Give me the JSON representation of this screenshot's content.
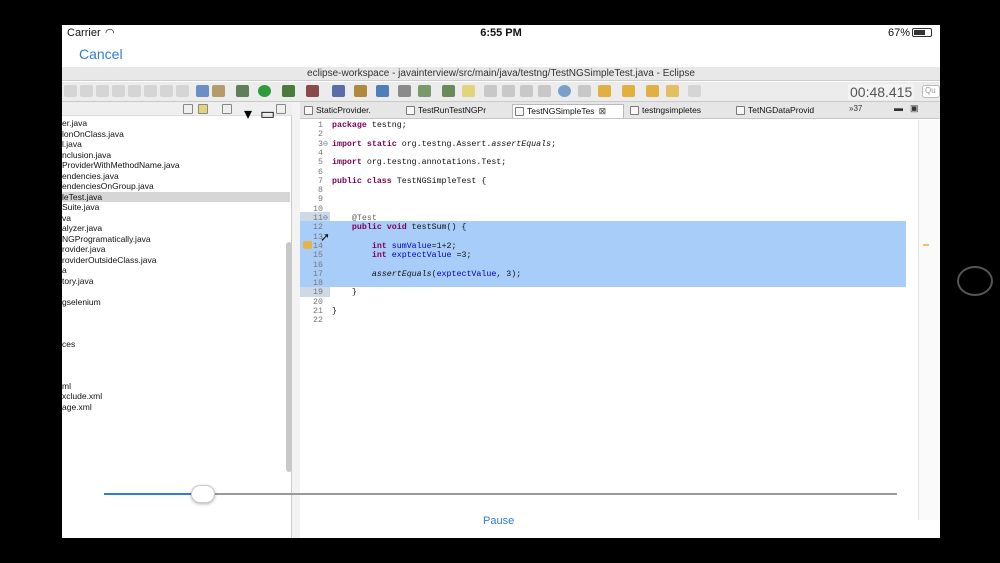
{
  "status": {
    "carrier": "Carrier",
    "time": "6:55 PM",
    "battery": "67%",
    "battery_level": 0.67
  },
  "nav": {
    "cancel": "Cancel"
  },
  "window": {
    "title": "eclipse-workspace - javainterview/src/main/java/testng/TestNGSimpleTest.java - Eclipse"
  },
  "toolbar": {
    "timer": "00:48.415",
    "quick_access_placeholder": "Qu"
  },
  "explorer": {
    "files": [
      "er.java",
      "lonOnClass.java",
      "l.java",
      "nclusion.java",
      "ProviderWithMethodName.java",
      "endencies.java",
      "endenciesOnGroup.java",
      "leTest.java",
      "Suite.java",
      "va",
      "alyzer.java",
      "NGProgramatically.java",
      "rovider.java",
      "roviderOutsideClass.java",
      "a",
      "tory.java",
      "",
      "gselenium",
      "",
      "",
      "",
      "ces",
      "",
      "",
      "",
      "ml",
      "xclude.xml",
      "age.xml"
    ],
    "selected_index": 7
  },
  "editor": {
    "tabs": [
      {
        "label": "StaticProvider."
      },
      {
        "label": "TestRunTestNGPr"
      },
      {
        "label": "TestNGSimpleTes",
        "active": true
      },
      {
        "label": "testngsimpletes"
      },
      {
        "label": "TetNGDataProvid"
      }
    ],
    "tabs_overflow": "»37",
    "lines": [
      {
        "n": "1",
        "text": "package testng;"
      },
      {
        "n": "2",
        "text": ""
      },
      {
        "n": "3",
        "text": "import static org.testng.Assert.assertEquals;"
      },
      {
        "n": "4",
        "text": ""
      },
      {
        "n": "5",
        "text": "import org.testng.annotations.Test;"
      },
      {
        "n": "6",
        "text": ""
      },
      {
        "n": "7",
        "text": "public class TestNGSimpleTest {"
      },
      {
        "n": "8",
        "text": ""
      },
      {
        "n": "9",
        "text": ""
      },
      {
        "n": "10",
        "text": ""
      },
      {
        "n": "11",
        "text": "    @Test"
      },
      {
        "n": "12",
        "text": "    public void testSum() {"
      },
      {
        "n": "13",
        "text": ""
      },
      {
        "n": "14",
        "text": "        int sumValue=1+2;"
      },
      {
        "n": "15",
        "text": "        int exptectValue =3;"
      },
      {
        "n": "16",
        "text": ""
      },
      {
        "n": "17",
        "text": "        assertEquals(exptectValue, 3);"
      },
      {
        "n": "18",
        "text": ""
      },
      {
        "n": "19",
        "text": "    }"
      },
      {
        "n": "20",
        "text": ""
      },
      {
        "n": "21",
        "text": "}"
      },
      {
        "n": "22",
        "text": ""
      }
    ]
  },
  "player": {
    "pause": "Pause",
    "progress": 0.12
  }
}
